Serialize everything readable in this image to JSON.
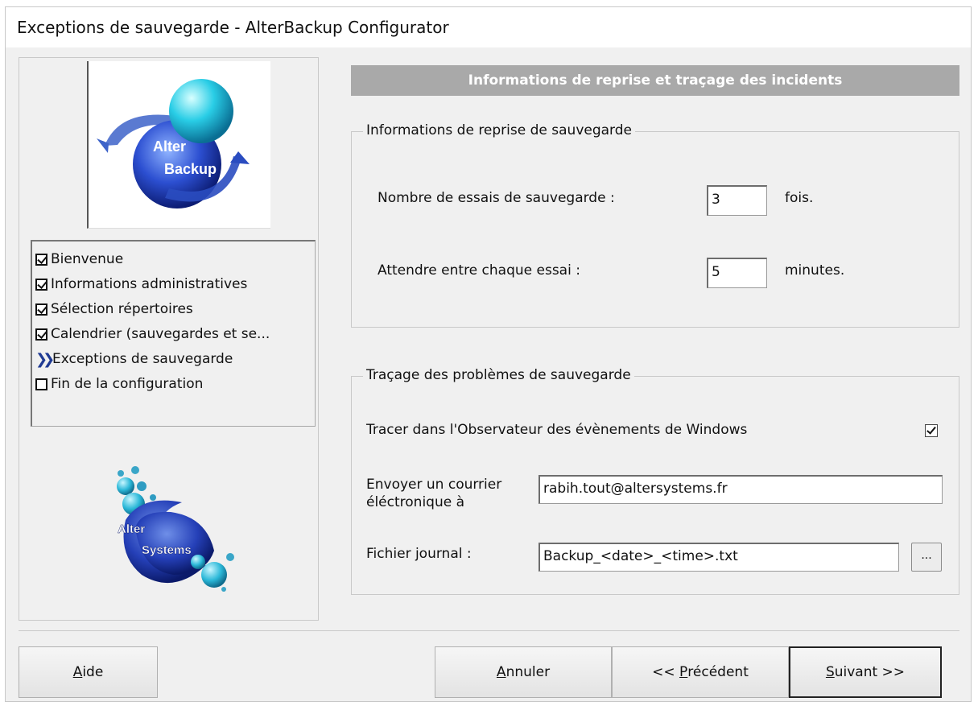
{
  "window": {
    "title": "Exceptions de sauvegarde - AlterBackup Configurator"
  },
  "logos": {
    "alterbackup": {
      "line1": "Alter",
      "line2": "Backup"
    },
    "altersystems": {
      "line1": "Alter",
      "line2": "Systems"
    }
  },
  "steps": [
    {
      "label": "Bienvenue",
      "state": "checked"
    },
    {
      "label": "Informations administratives",
      "state": "checked"
    },
    {
      "label": "Sélection répertoires",
      "state": "checked"
    },
    {
      "label": "Calendrier (sauvegardes et se...",
      "state": "checked"
    },
    {
      "label": "Exceptions de sauvegarde",
      "state": "current"
    },
    {
      "label": "Fin de la configuration",
      "state": "unchecked"
    }
  ],
  "header": {
    "title": "Informations de reprise et traçage des incidents"
  },
  "retry_group": {
    "legend": "Informations de reprise de sauvegarde",
    "attempts_label": "Nombre de essais de sauvegarde :",
    "attempts_value": "3",
    "attempts_unit": "fois.",
    "wait_label": "Attendre entre chaque essai :",
    "wait_value": "5",
    "wait_unit": "minutes."
  },
  "trace_group": {
    "legend": "Traçage des problèmes de sauvegarde",
    "event_log_label": "Tracer dans l'Observateur des évènements de Windows",
    "event_log_checked": true,
    "email_label_line1": "Envoyer un courrier",
    "email_label_line2": "éléctronique à",
    "email_value": "rabih.tout@altersystems.fr",
    "logfile_label": "Fichier journal :",
    "logfile_value": "Backup_<date>_<time>.txt",
    "browse_label": "..."
  },
  "buttons": {
    "help": {
      "mnemonic": "A",
      "rest": "ide"
    },
    "cancel": {
      "mnemonic": "A",
      "rest": "nnuler"
    },
    "previous": {
      "prefix": "<< ",
      "mnemonic": "P",
      "rest": "récédent"
    },
    "next": {
      "mnemonic": "S",
      "rest": "uivant >>"
    }
  },
  "colors": {
    "header_bg": "#a9a9a9",
    "accent_blue": "#1f3a93",
    "window_bg": "#f0f0f0"
  }
}
